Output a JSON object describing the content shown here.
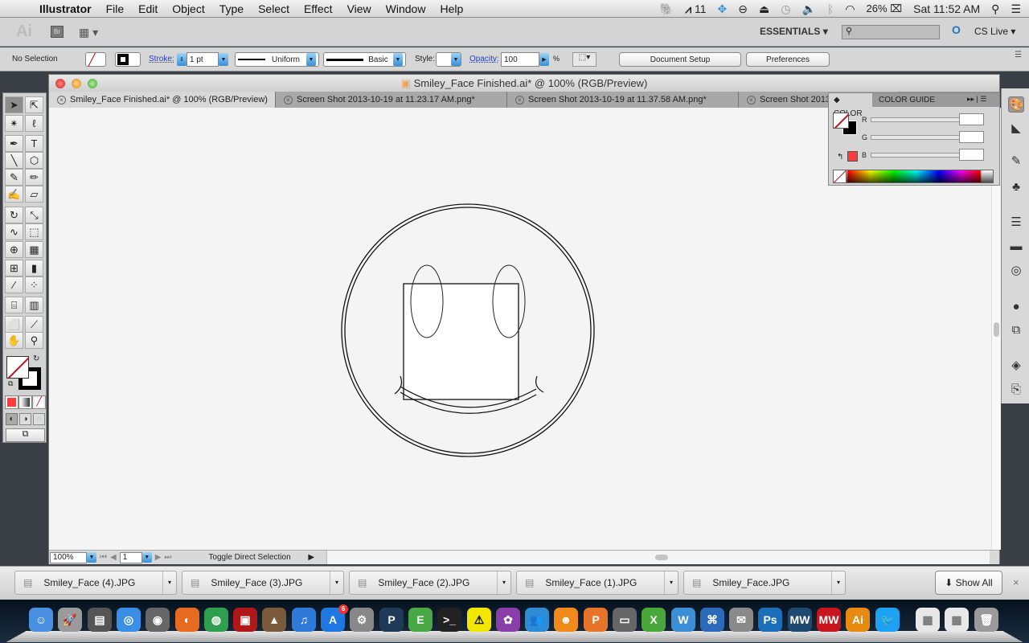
{
  "menubar": {
    "apple_icon": "apple-logo",
    "app_name": "Illustrator",
    "items": [
      "File",
      "Edit",
      "Object",
      "Type",
      "Select",
      "Effect",
      "View",
      "Window",
      "Help"
    ],
    "status": {
      "adobe_badge": "11",
      "battery": "26%",
      "clock": "Sat 11:52 AM"
    }
  },
  "appbar": {
    "logo": "Ai",
    "bridge": "Br",
    "workspace": "ESSENTIALS",
    "search_placeholder": "",
    "cs_live": "CS Live"
  },
  "controlbar": {
    "selection": "No Selection",
    "stroke_label": "Stroke:",
    "stroke_value": "1 pt",
    "profile": "Uniform",
    "brush": "Basic",
    "style_label": "Style:",
    "opacity_label": "Opacity:",
    "opacity_value": "100",
    "percent": "%",
    "document_setup": "Document Setup",
    "preferences": "Preferences"
  },
  "document": {
    "title": "Smiley_Face Finished.ai* @ 100% (RGB/Preview)",
    "tabs": [
      {
        "label": "Smiley_Face Finished.ai* @ 100% (RGB/Preview)",
        "active": true
      },
      {
        "label": "Screen Shot 2013-10-19 at 11.23.17 AM.png*",
        "active": false
      },
      {
        "label": "Screen Shot 2013-10-19 at 11.37.58 AM.png*",
        "active": false
      },
      {
        "label": "Screen Shot 2013",
        "active": false
      }
    ],
    "zoom": "100%",
    "page": "1",
    "status_text": "Toggle Direct Selection"
  },
  "color_panel": {
    "tabs": [
      "COLOR",
      "COLOR GUIDE"
    ],
    "channels": [
      {
        "label": "R",
        "value": ""
      },
      {
        "label": "G",
        "value": ""
      },
      {
        "label": "B",
        "value": ""
      }
    ],
    "out_of_gamut_color": "#ff3b3b"
  },
  "toolbox": {
    "tools": [
      {
        "name": "selection-tool",
        "glyph": "➤"
      },
      {
        "name": "direct-selection-tool",
        "glyph": "⇱"
      },
      {
        "name": "magic-wand-tool",
        "glyph": "✴"
      },
      {
        "name": "lasso-tool",
        "glyph": "ℓ"
      },
      {
        "name": "pen-tool",
        "glyph": "✒"
      },
      {
        "name": "type-tool",
        "glyph": "T"
      },
      {
        "name": "line-tool",
        "glyph": "╲"
      },
      {
        "name": "polygon-tool",
        "glyph": "⬡"
      },
      {
        "name": "paintbrush-tool",
        "glyph": "✎"
      },
      {
        "name": "pencil-tool",
        "glyph": "✏"
      },
      {
        "name": "blob-brush-tool",
        "glyph": "✍"
      },
      {
        "name": "eraser-tool",
        "glyph": "▱"
      },
      {
        "name": "rotate-tool",
        "glyph": "↻"
      },
      {
        "name": "scale-tool",
        "glyph": "⤡"
      },
      {
        "name": "warp-tool",
        "glyph": "∿"
      },
      {
        "name": "free-transform-tool",
        "glyph": "⬚"
      },
      {
        "name": "shape-builder-tool",
        "glyph": "⊕"
      },
      {
        "name": "perspective-grid-tool",
        "glyph": "▦"
      },
      {
        "name": "mesh-tool",
        "glyph": "⊞"
      },
      {
        "name": "gradient-tool",
        "glyph": "▮"
      },
      {
        "name": "eyedropper-tool",
        "glyph": "⁄"
      },
      {
        "name": "blend-tool",
        "glyph": "⁘"
      },
      {
        "name": "symbol-sprayer-tool",
        "glyph": "⌸"
      },
      {
        "name": "column-graph-tool",
        "glyph": "▥"
      },
      {
        "name": "artboard-tool",
        "glyph": "⬜"
      },
      {
        "name": "slice-tool",
        "glyph": "⟋"
      },
      {
        "name": "hand-tool",
        "glyph": "✋"
      },
      {
        "name": "zoom-tool",
        "glyph": "⚲"
      }
    ],
    "fill_color": "#ff3b3b"
  },
  "downloads": {
    "items": [
      "Smiley_Face (4).JPG",
      "Smiley_Face (3).JPG",
      "Smiley_Face (2).JPG",
      "Smiley_Face (1).JPG",
      "Smiley_Face.JPG"
    ],
    "show_all": "Show All"
  },
  "dock": {
    "apps": [
      {
        "name": "finder",
        "color": "#4a90e2",
        "glyph": "☺"
      },
      {
        "name": "launchpad",
        "color": "#9a9a9a",
        "glyph": "🚀"
      },
      {
        "name": "mission-control",
        "color": "#555",
        "glyph": "▤"
      },
      {
        "name": "safari",
        "color": "#3a8ee6",
        "glyph": "◎"
      },
      {
        "name": "facetime",
        "color": "#666",
        "glyph": "◉"
      },
      {
        "name": "firefox",
        "color": "#e66a1f",
        "glyph": "◐"
      },
      {
        "name": "chrome",
        "color": "#2e9e4f",
        "glyph": "◍"
      },
      {
        "name": "photo-booth",
        "color": "#b01818",
        "glyph": "▣"
      },
      {
        "name": "iphoto",
        "color": "#7a5a3a",
        "glyph": "▲"
      },
      {
        "name": "itunes",
        "color": "#2f7ad8",
        "glyph": "♫"
      },
      {
        "name": "app-store",
        "color": "#1f78e0",
        "glyph": "A"
      },
      {
        "name": "system-preferences",
        "color": "#888",
        "glyph": "⚙"
      },
      {
        "name": "p-app",
        "color": "#1e3a56",
        "glyph": "P"
      },
      {
        "name": "evernote",
        "color": "#47a845",
        "glyph": "E"
      },
      {
        "name": "terminal",
        "color": "#222",
        "glyph": ">_"
      },
      {
        "name": "replicatorg",
        "color": "#f2e600",
        "glyph": "⚠"
      },
      {
        "name": "purple-app",
        "color": "#8a3ea8",
        "glyph": "✿"
      },
      {
        "name": "messenger",
        "color": "#2e8bd6",
        "glyph": "👥"
      },
      {
        "name": "scratch",
        "color": "#f08a1a",
        "glyph": "☻"
      },
      {
        "name": "powerpoint",
        "color": "#e8742a",
        "glyph": "P"
      },
      {
        "name": "window-app",
        "color": "#666",
        "glyph": "▭"
      },
      {
        "name": "excel",
        "color": "#4aa83a",
        "glyph": "X"
      },
      {
        "name": "word",
        "color": "#3a8fd6",
        "glyph": "W"
      },
      {
        "name": "network-app",
        "color": "#2a6ab8",
        "glyph": "⌘"
      },
      {
        "name": "preview",
        "color": "#8a8a8a",
        "glyph": "✉"
      },
      {
        "name": "photoshop",
        "color": "#1a6fb8",
        "glyph": "Ps"
      },
      {
        "name": "makerware",
        "color": "#1e4a72",
        "glyph": "MW"
      },
      {
        "name": "makerware-d",
        "color": "#c8161e",
        "glyph": "MW"
      },
      {
        "name": "illustrator",
        "color": "#e88a12",
        "glyph": "Ai"
      },
      {
        "name": "twitter",
        "color": "#1da1f2",
        "glyph": "🐦"
      },
      {
        "name": "document-stack-1",
        "color": "#e8e8e8",
        "glyph": "▦"
      },
      {
        "name": "document-stack-2",
        "color": "#e8e8e8",
        "glyph": "▦"
      },
      {
        "name": "trash",
        "color": "#9a9a9a",
        "glyph": "🗑"
      }
    ],
    "app_store_badge": "6"
  }
}
